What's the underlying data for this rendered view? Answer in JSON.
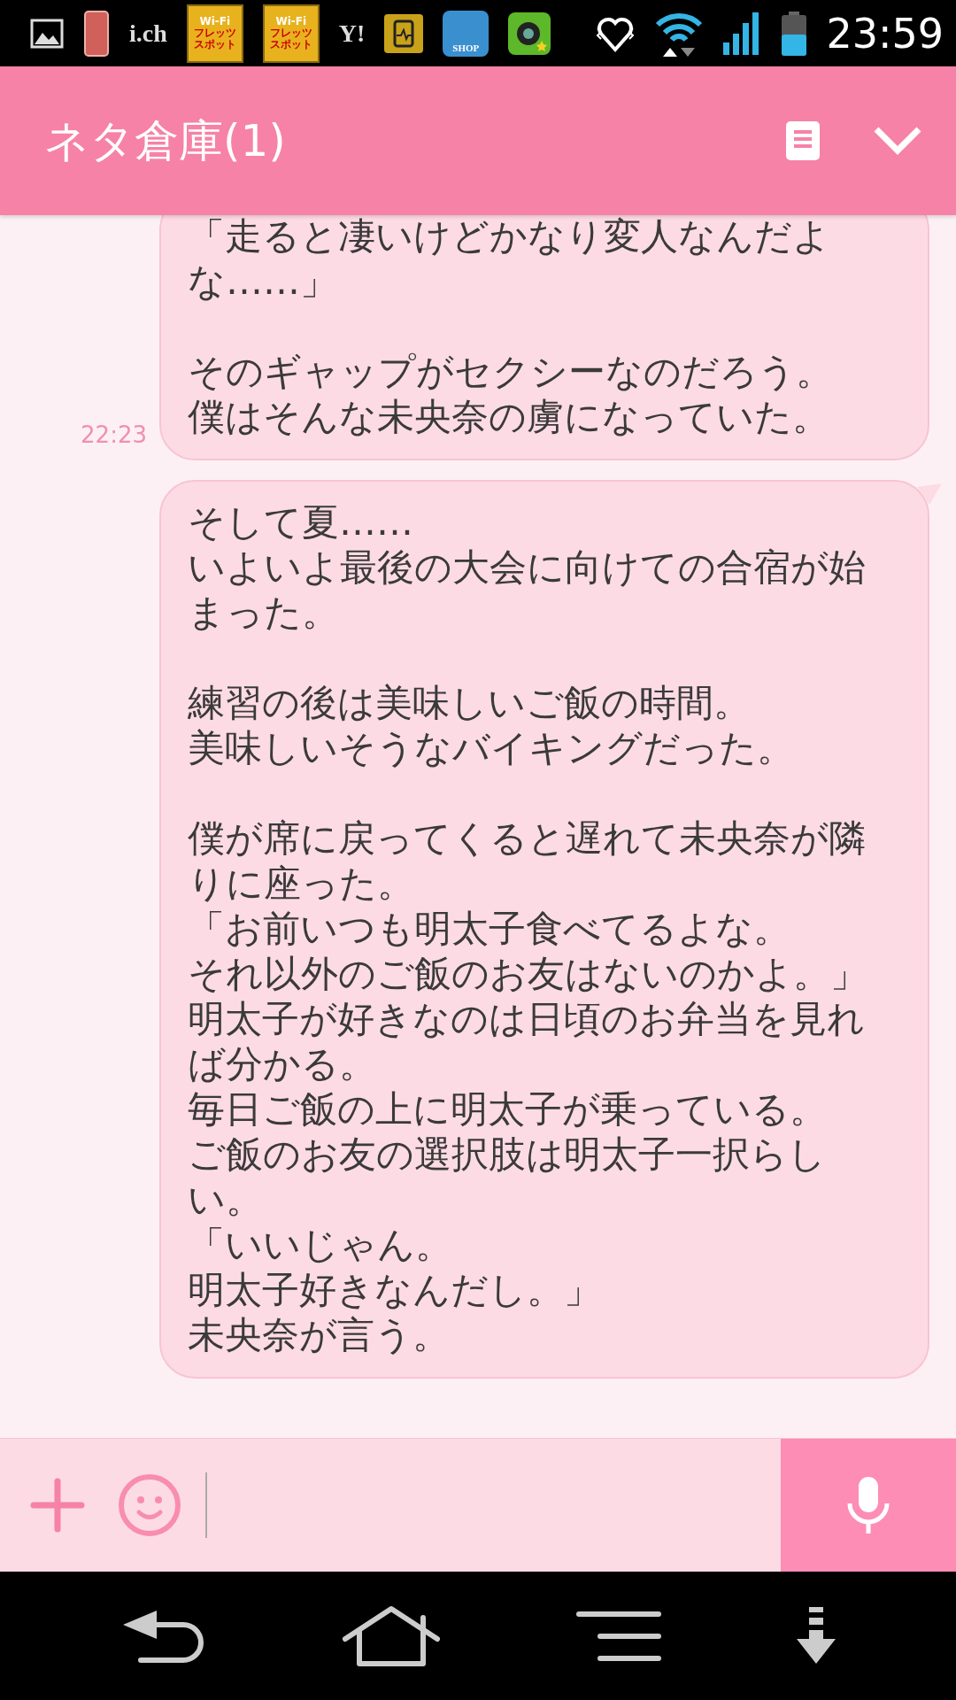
{
  "status_bar": {
    "icons": [
      {
        "kind": "gallery"
      },
      {
        "kind": "phone"
      },
      {
        "kind": "text",
        "label": "i.ch"
      },
      {
        "kind": "wifi_spot",
        "label": "Wi-Fi",
        "sub": "フレッツ",
        "sub2": "スポット"
      },
      {
        "kind": "wifi_spot",
        "label": "Wi-Fi",
        "sub": "フレッツ",
        "sub2": "スポット"
      },
      {
        "kind": "text",
        "label": "Y!"
      },
      {
        "kind": "battery_app"
      },
      {
        "kind": "shop",
        "label": "SHOP"
      },
      {
        "kind": "camera"
      }
    ],
    "time": "23:59"
  },
  "header": {
    "title": "ネタ倉庫(1)"
  },
  "messages": [
    {
      "time": "22:23",
      "paragraphs": [
        [
          "「走ると凄いけどかなり変人なんだよな……」"
        ],
        [
          "そのギャップがセクシーなのだろう。",
          "僕はそんな未央奈の虜になっていた。"
        ]
      ]
    },
    {
      "tail": true,
      "paragraphs": [
        [
          "そして夏……",
          "いよいよ最後の大会に向けての合宿が始まった。"
        ],
        [
          "練習の後は美味しいご飯の時間。",
          "美味しいそうなバイキングだった。"
        ],
        [
          "僕が席に戻ってくると遅れて未央奈が隣りに座った。",
          "「お前いつも明太子食べてるよな。",
          "それ以外のご飯のお友はないのかよ。」",
          "明太子が好きなのは日頃のお弁当を見れば分かる。",
          "毎日ご飯の上に明太子が乗っている。",
          "ご飯のお友の選択肢は明太子一択らしい。",
          "「いいじゃん。",
          "明太子好きなんだし。」",
          "未央奈が言う。"
        ]
      ]
    }
  ]
}
